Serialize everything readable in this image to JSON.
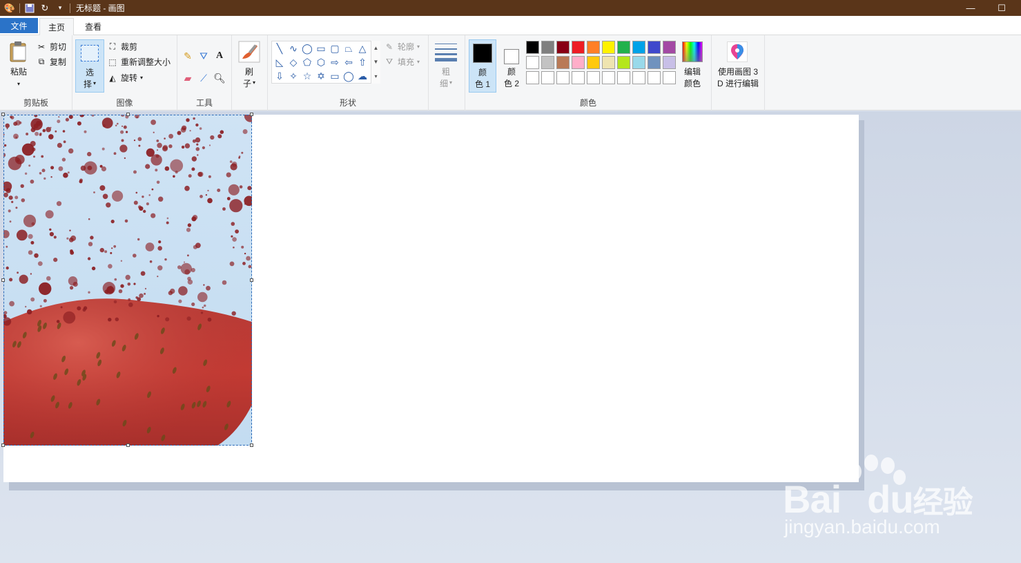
{
  "titlebar": {
    "title": "无标题 - 画图",
    "icons": [
      "paint-app-icon",
      "save-icon",
      "redo-icon",
      "customize-quick-access-icon"
    ],
    "minimize_glyph": "—",
    "maximize_glyph": "☐"
  },
  "tabs": {
    "file": "文件",
    "home": "主页",
    "view": "查看"
  },
  "clipboard": {
    "paste": "粘贴",
    "cut": "剪切",
    "copy": "复制",
    "group": "剪贴板"
  },
  "image": {
    "select_1": "选",
    "select_2": "择",
    "crop": "裁剪",
    "resize": "重新调整大小",
    "rotate": "旋转",
    "group": "图像"
  },
  "tools": {
    "group": "工具"
  },
  "brushes": {
    "label_1": "刷",
    "label_2": "子"
  },
  "shapes": {
    "outline": "轮廓",
    "fill": "填充",
    "group": "形状"
  },
  "size": {
    "label_1": "粗",
    "label_2": "细"
  },
  "colors": {
    "color1_a": "颜",
    "color1_b": "色 1",
    "color2_a": "颜",
    "color2_b": "色 2",
    "edit_a": "编辑",
    "edit_b": "颜色",
    "group": "颜色",
    "color1_value": "#000000",
    "color2_value": "#ffffff",
    "palette": [
      "#000000",
      "#7f7f7f",
      "#880015",
      "#ed1c24",
      "#ff7f27",
      "#fff200",
      "#22b14c",
      "#00a2e8",
      "#3f48cc",
      "#a349a4",
      "#ffffff",
      "#c3c3c3",
      "#b97a57",
      "#ffaec9",
      "#ffc90e",
      "#efe4b0",
      "#b5e61d",
      "#99d9ea",
      "#7092be",
      "#c8bfe7",
      "#ffffff",
      "#ffffff",
      "#ffffff",
      "#ffffff",
      "#ffffff",
      "#ffffff",
      "#ffffff",
      "#ffffff",
      "#ffffff",
      "#ffffff"
    ]
  },
  "paint3d": {
    "label_1": "使用画图 3",
    "label_2": "D 进行编辑"
  },
  "watermark": {
    "brand": "Bai",
    "brand_tail": "du",
    "brand_cn": "经验",
    "url": "jingyan.baidu.com"
  }
}
